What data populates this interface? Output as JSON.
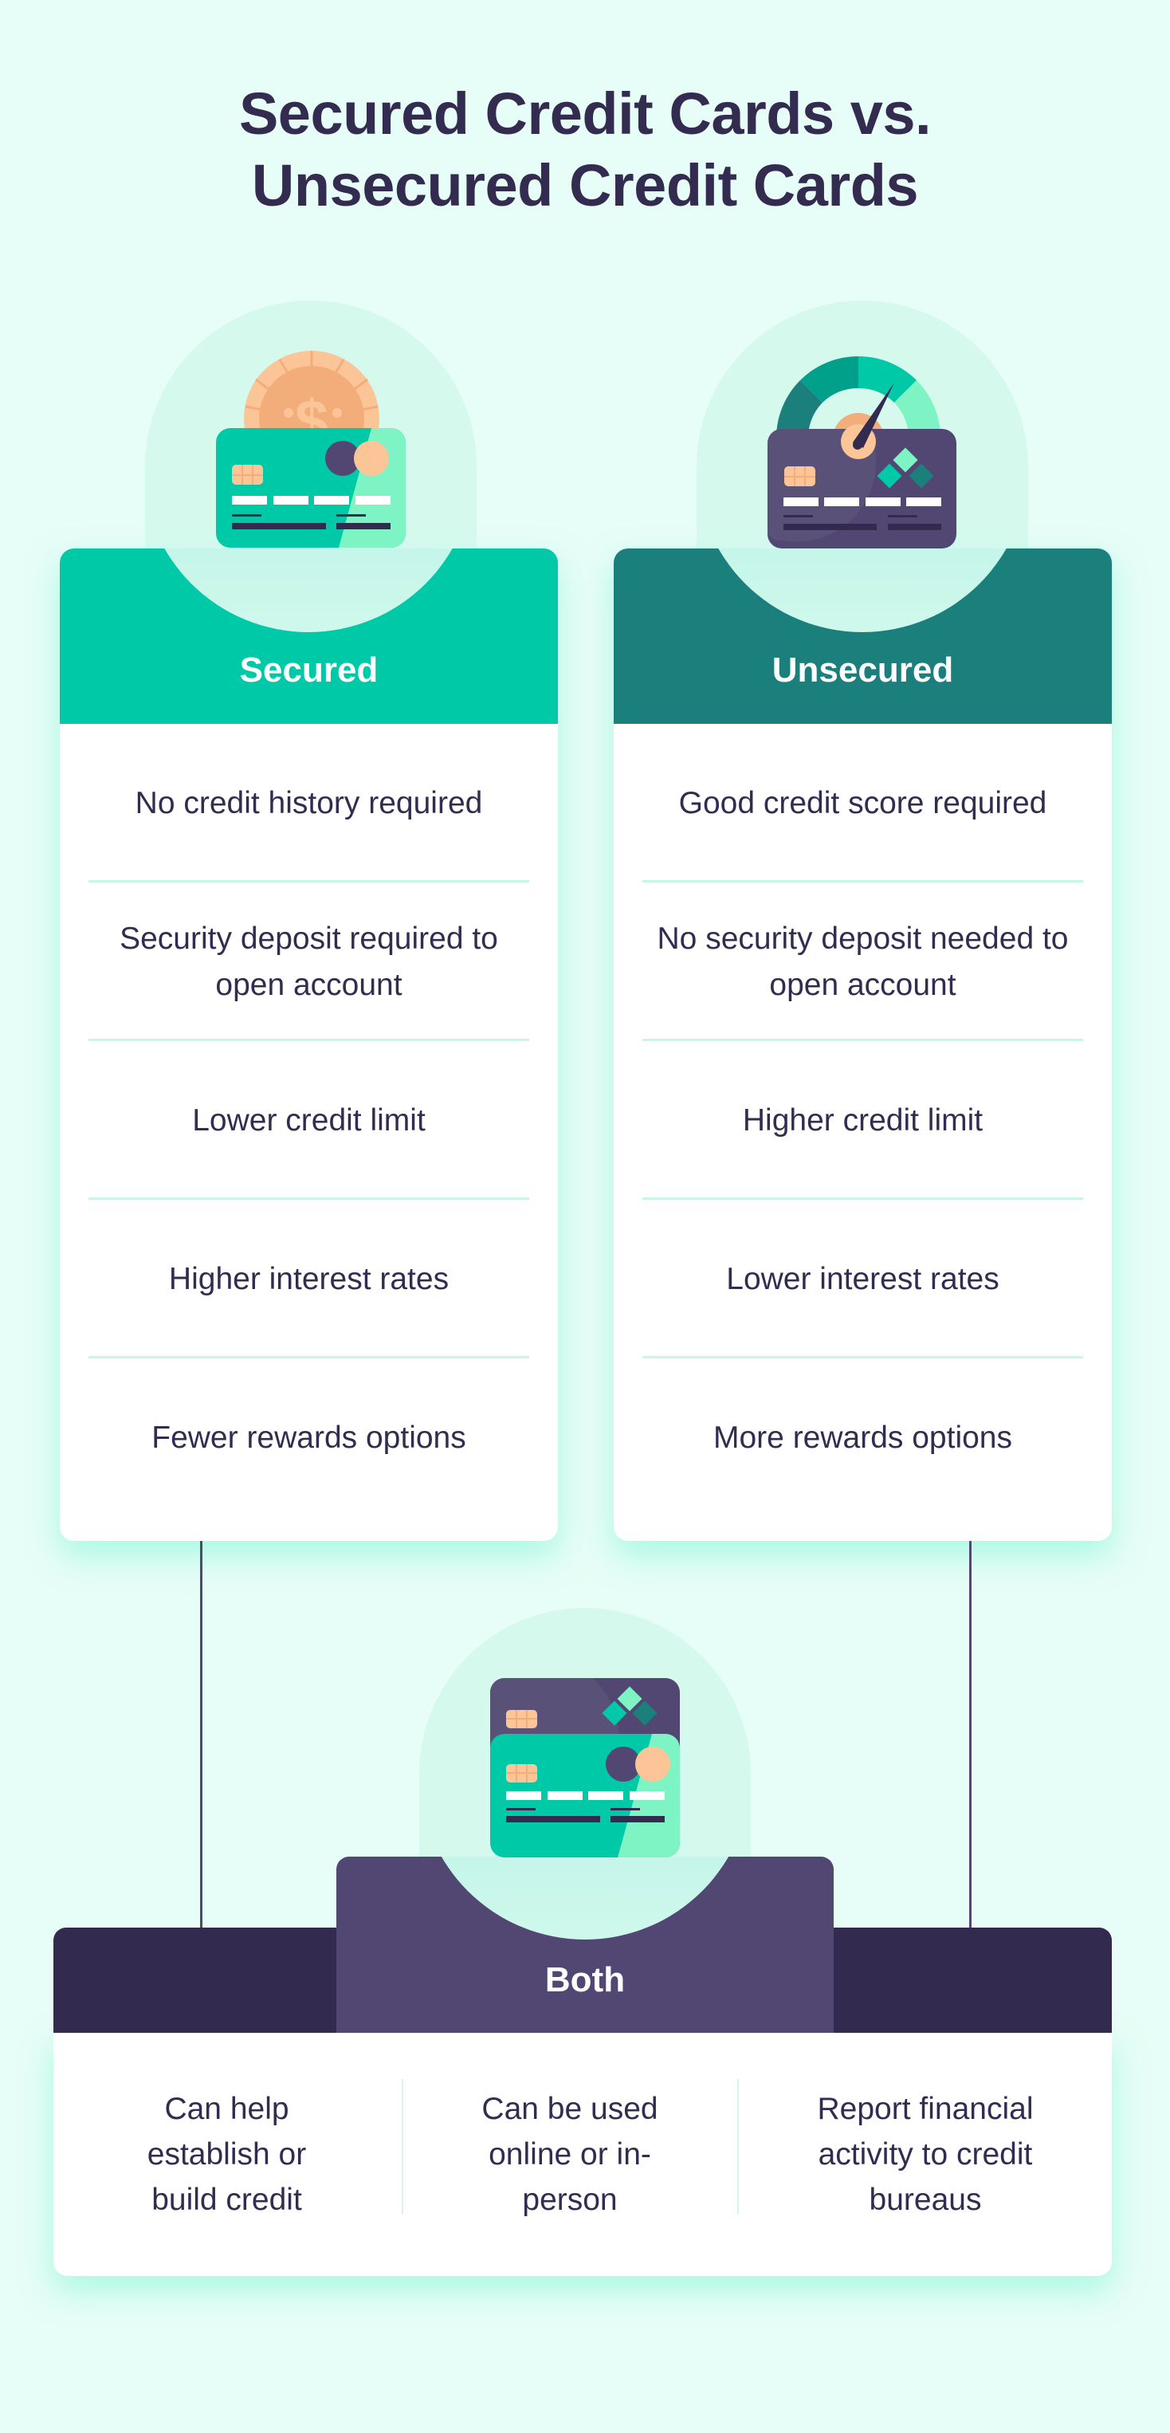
{
  "title": {
    "line1": "Secured Credit Cards vs.",
    "line2": "Unsecured Credit Cards"
  },
  "colors": {
    "background": "#e7fdf7",
    "secured_header": "#00c9a7",
    "unsecured_header": "#1b7f7c",
    "both_bar": "#332b4f",
    "both_tab": "#514772",
    "text": "#342c50",
    "divider": "#c8f7ea",
    "coin": "#f3ad7b",
    "card_purple": "#514772",
    "card_green": "#00c9a7",
    "card_mint": "#7ef3c3"
  },
  "secured": {
    "label": "Secured",
    "icon": "coin-credit-card-icon",
    "items": [
      "No credit history required",
      "Security deposit required to open account",
      "Lower credit limit",
      "Higher interest rates",
      "Fewer rewards options"
    ]
  },
  "unsecured": {
    "label": "Unsecured",
    "icon": "credit-score-gauge-card-icon",
    "items": [
      "Good credit score required",
      "No security deposit needed to open account",
      "Higher credit limit",
      "Lower interest rates",
      "More rewards options"
    ]
  },
  "both": {
    "label": "Both",
    "icon": "two-credit-cards-icon",
    "items": [
      "Can help establish or build credit",
      "Can be used online or in-person",
      "Report financial activity to credit bureaus"
    ]
  }
}
